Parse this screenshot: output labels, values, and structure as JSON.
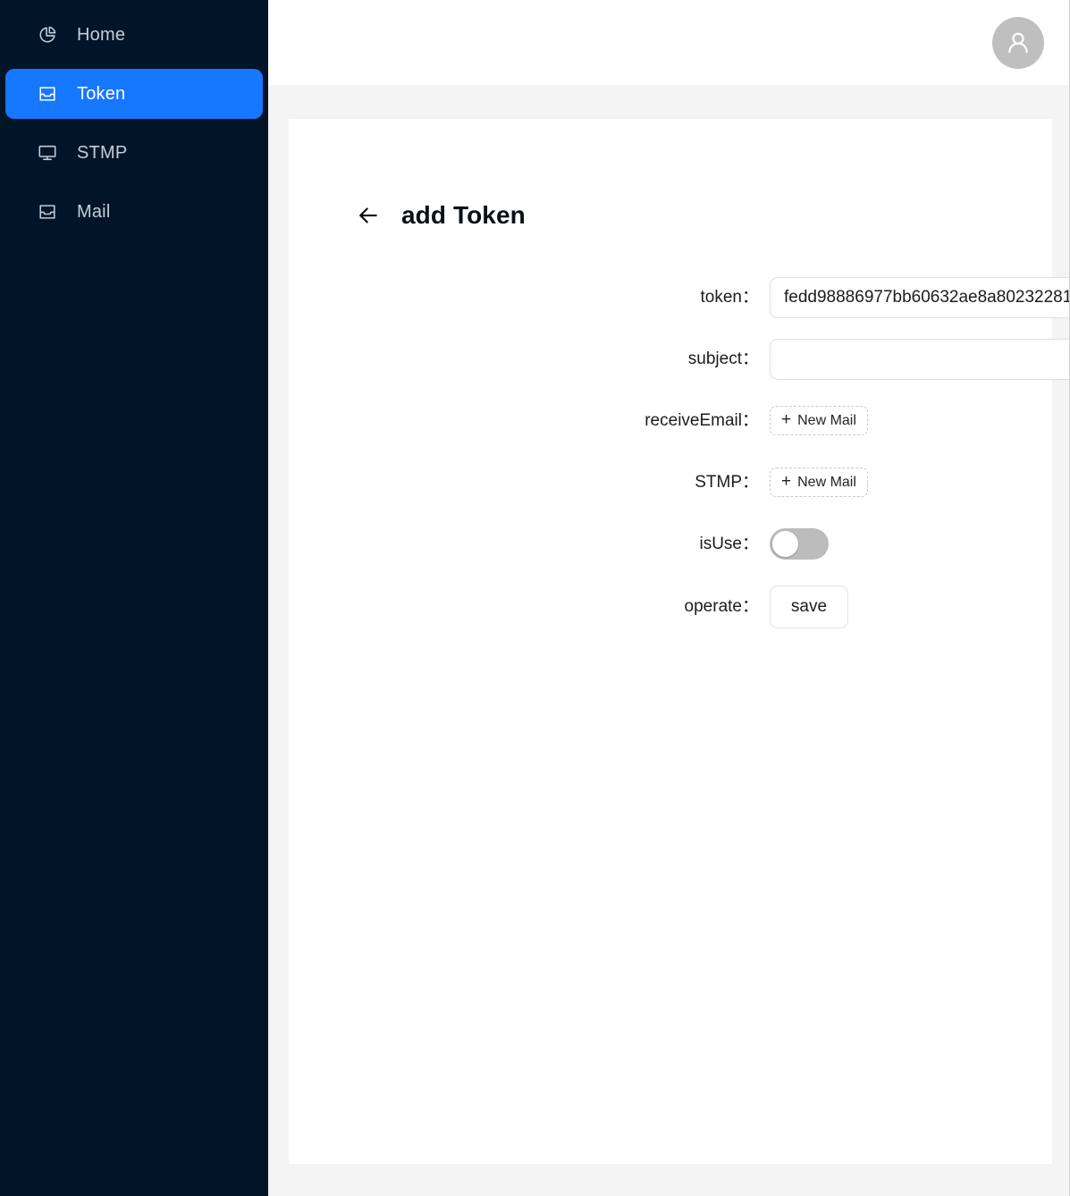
{
  "sidebar": {
    "items": [
      {
        "id": "home",
        "label": "Home",
        "icon": "pie-chart-icon",
        "active": false
      },
      {
        "id": "token",
        "label": "Token",
        "icon": "inbox-icon",
        "active": true
      },
      {
        "id": "stmp",
        "label": "STMP",
        "icon": "monitor-icon",
        "active": false
      },
      {
        "id": "mail",
        "label": "Mail",
        "icon": "inbox-icon",
        "active": false
      }
    ],
    "active_color": "#1677ff",
    "background_color": "#021528"
  },
  "topbar": {
    "avatar_icon": "user-avatar-icon"
  },
  "page": {
    "back_icon": "arrow-left-icon",
    "title": "add Token"
  },
  "form": {
    "rows": {
      "token": {
        "label": "token：",
        "value": "fedd98886977bb60632ae8a80232281",
        "placeholder": ""
      },
      "subject": {
        "label": "subject：",
        "value": "",
        "placeholder": ""
      },
      "receive_email": {
        "label": "receiveEmail：",
        "button_label": "New Mail",
        "button_plus": "+"
      },
      "stmp": {
        "label": "STMP：",
        "button_label": "New Mail",
        "button_plus": "+"
      },
      "is_use": {
        "label": "isUse：",
        "state": "off"
      },
      "operate": {
        "label": "operate：",
        "save_label": "save"
      }
    }
  }
}
